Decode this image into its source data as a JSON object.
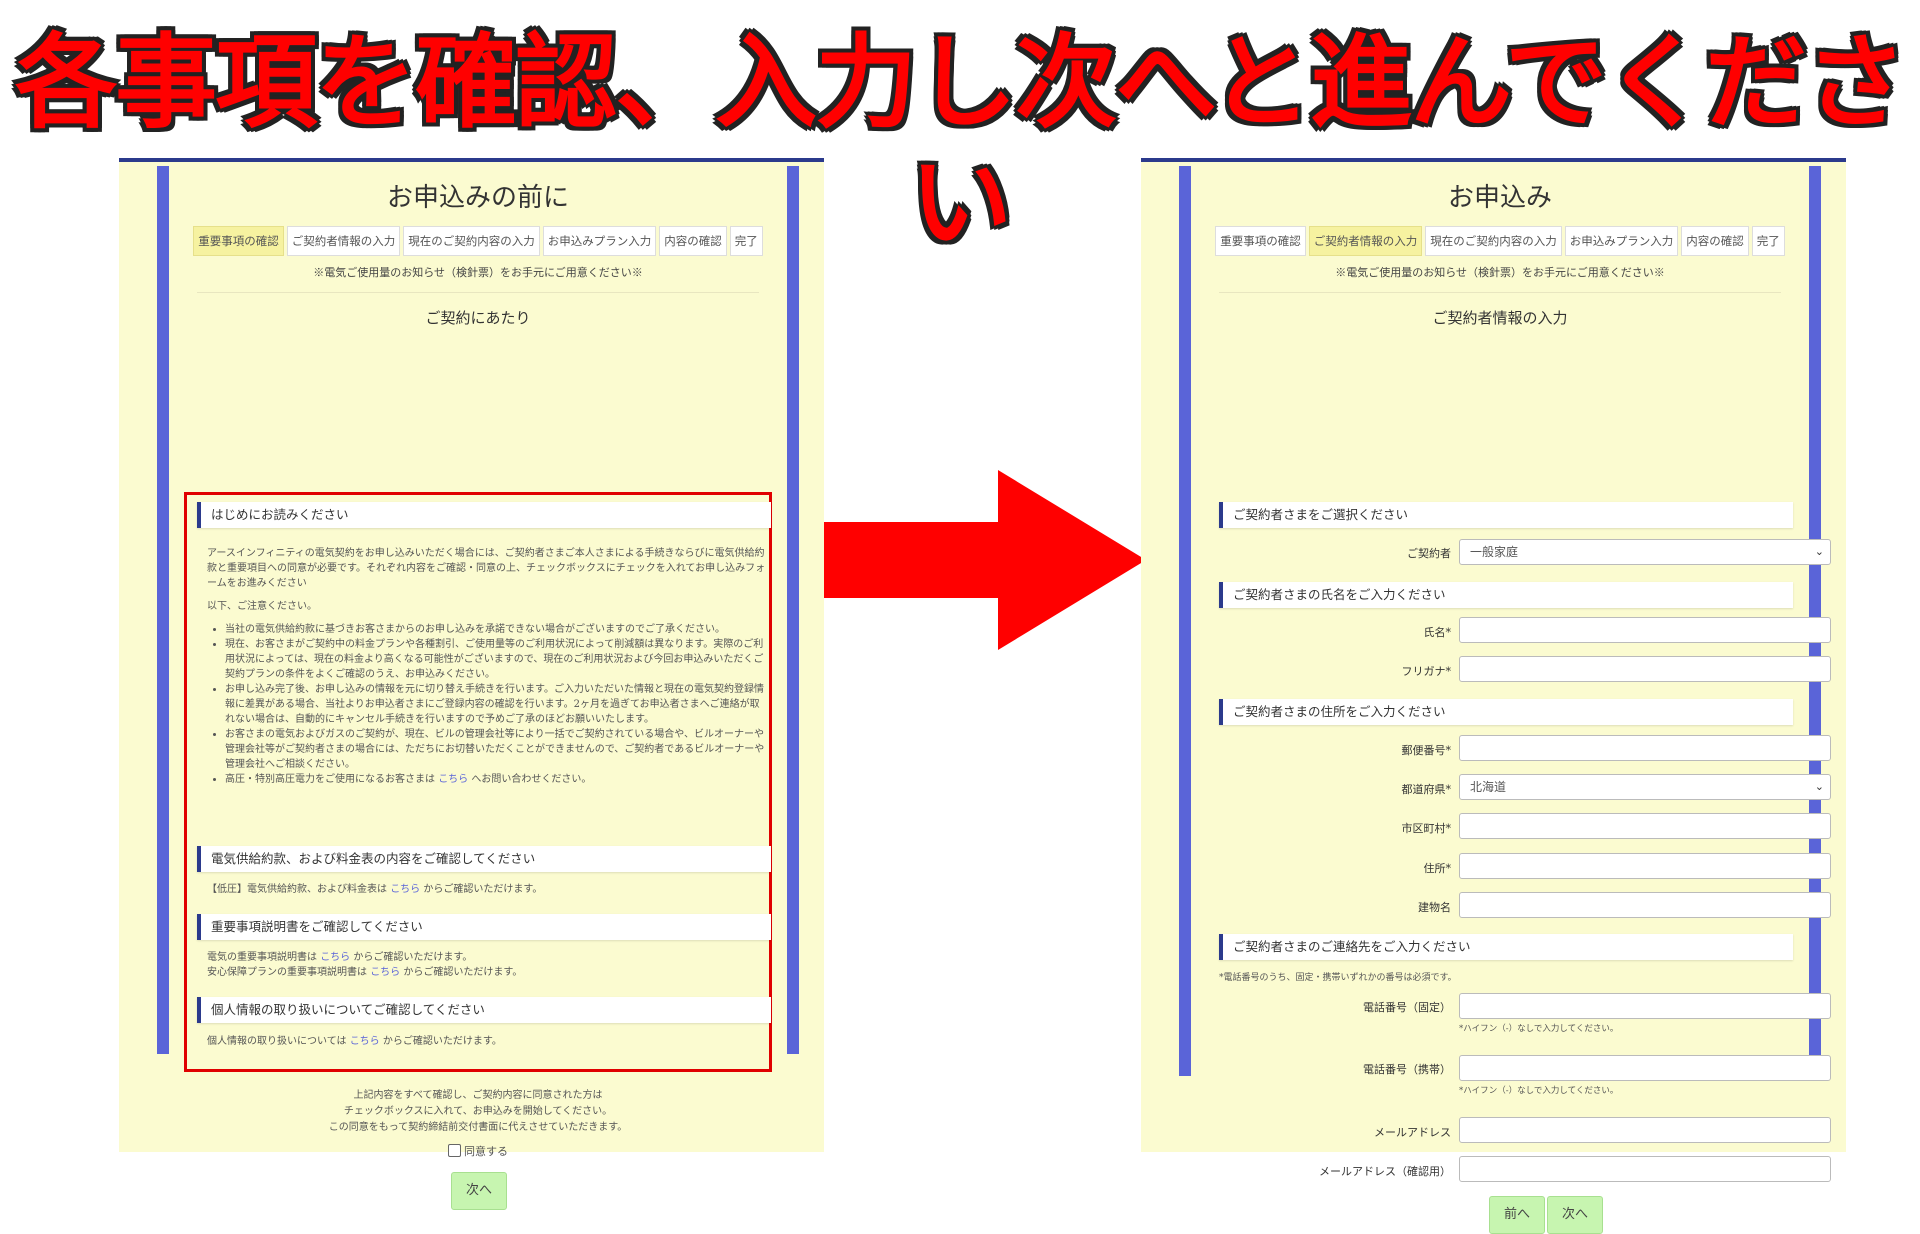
{
  "headline": "各事項を確認、入力し次へと進んでください",
  "left": {
    "title": "お申込みの前に",
    "steps": [
      "重要事項の確認",
      "ご契約者情報の入力",
      "現在のご契約内容の入力",
      "お申込みプラン入力",
      "内容の確認",
      "完了"
    ],
    "notice": "※電気ご使用量のお知らせ（検針票）をお手元にご用意ください※",
    "section_title": "ご契約にあたり",
    "s1": {
      "heading": "はじめにお読みください",
      "intro": "アースインフィニティの電気契約をお申し込みいただく場合には、ご契約者さまご本人さまによる手続きならびに電気供給約款と重要項目への同意が必要です。それぞれ内容をご確認・同意の上、チェックボックスにチェックを入れてお申し込みフォームをお進みください",
      "caution": "以下、ご注意ください。",
      "bullets": [
        "当社の電気供給約款に基づきお客さまからのお申し込みを承諾できない場合がございますのでご了承ください。",
        "現在、お客さまがご契約中の料金プランや各種割引、ご使用量等のご利用状況によって削減額は異なります。実際のご利用状況によっては、現在の料金より高くなる可能性がございますので、現在のご利用状況および今回お申込みいただくご契約プランの条件をよくご確認のうえ、お申込みください。",
        "お申し込み完了後、お申し込みの情報を元に切り替え手続きを行います。ご入力いただいた情報と現在の電気契約登録情報に差異がある場合、当社よりお申込者さまにご登録内容の確認を行います。2ヶ月を過ぎてお申込者さまへご連絡が取れない場合は、自動的にキャンセル手続きを行いますので予めご了承のほどお願いいたします。",
        "お客さまの電気およびガスのご契約が、現在、ビルの管理会社等により一括でご契約されている場合や、ビルオーナーや管理会社等がご契約者さまの場合には、ただちにお切替いただくことができませんので、ご契約者であるビルオーナーや管理会社へご相談ください。"
      ],
      "last_bullet_pre": "高圧・特別高圧電力をご使用になるお客さまは ",
      "last_bullet_link": "こちら",
      "last_bullet_post": " へお問い合わせください。"
    },
    "s2": {
      "heading": "電気供給約款、および料金表の内容をご確認してください",
      "pre": "【低圧】電気供給約款、および料金表は ",
      "link": "こちら",
      "post": " からご確認いただけます。"
    },
    "s3": {
      "heading": "重要事項説明書をご確認してください",
      "l1_pre": "電気の重要事項説明書は ",
      "l1_link": "こちら",
      "l1_post": " からご確認いただけます。",
      "l2_pre": "安心保障プランの重要事項説明書は ",
      "l2_link": "こちら",
      "l2_post": " からご確認いただけます。"
    },
    "s4": {
      "heading": "個人情報の取り扱いについてご確認してください",
      "pre": "個人情報の取り扱いについては ",
      "link": "こちら",
      "post": " からご確認いただけます。"
    },
    "agree_lines": [
      "上記内容をすべて確認し、ご契約内容に同意された方は",
      "チェックボックスに入れて、お申込みを開始してください。",
      "この同意をもって契約締結前交付書面に代えさせていただきます。"
    ],
    "agree_label": "同意する",
    "next_label": "次へ"
  },
  "right": {
    "title": "お申込み",
    "steps": [
      "重要事項の確認",
      "ご契約者情報の入力",
      "現在のご契約内容の入力",
      "お申込みプラン入力",
      "内容の確認",
      "完了"
    ],
    "notice": "※電気ご使用量のお知らせ（検針票）をお手元にご用意ください※",
    "section_title": "ご契約者情報の入力",
    "h_select": "ご契約者さまをご選択ください",
    "contract_label": "ご契約者",
    "contract_value": "一般家庭",
    "h_name": "ご契約者さまの氏名をご入力ください",
    "name_label": "氏名*",
    "kana_label": "フリガナ*",
    "h_address": "ご契約者さまの住所をご入力ください",
    "zip_label": "郵便番号*",
    "pref_label": "都道府県*",
    "pref_value": "北海道",
    "city_label": "市区町村*",
    "addr_label": "住所*",
    "bldg_label": "建物名",
    "h_contact": "ご契約者さまのご連絡先をご入力ください",
    "phone_note": "*電話番号のうち、固定・携帯いずれかの番号は必須です。",
    "tel_fixed_label": "電話番号（固定）",
    "tel_mobile_label": "電話番号（携帯）",
    "hyphen_hint": "*ハイフン（-）なしで入力してください。",
    "email_label": "メールアドレス",
    "email_confirm_label": "メールアドレス（確認用）",
    "prev_label": "前へ",
    "next_label": "次へ"
  },
  "colors": {
    "headline": "#ff0000",
    "arrow": "#ff0000",
    "panel_bg": "#fbfbd0",
    "rail": "#5a64d8",
    "button": "#c7f5b0",
    "highlight_box": "#e00000"
  }
}
